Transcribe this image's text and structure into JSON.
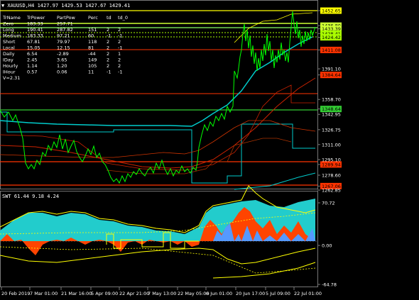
{
  "header": {
    "symbol_line": "▼ XAUUSD,H4  1427.97 1429.53 1427.67 1429.41",
    "indicator_line": "SWT 61.44 9.18 4.24"
  },
  "table": {
    "headers": [
      "TrName",
      "TrPower",
      "PartPow",
      "Perc",
      "td",
      "td_0"
    ],
    "rows": [
      [
        "Zero",
        "183.33",
        "257.71",
        "",
        "",
        ""
      ],
      [
        "Long",
        "190.41",
        "287.82",
        "151",
        "2",
        "2"
      ],
      [
        "Medium",
        "183.33",
        "97.21",
        "60",
        "-1",
        "-1"
      ],
      [
        "Short",
        "67.81",
        "79.97",
        "118",
        "2",
        "2"
      ],
      [
        "Local",
        "15.05",
        "12.15",
        "81",
        "2",
        "-1"
      ],
      [
        "Daily",
        "6.54",
        "-2.89",
        "-44",
        "2",
        "1"
      ],
      [
        "IDay",
        "2.45",
        "3.65",
        "149",
        "2",
        "2"
      ],
      [
        "Hourly",
        "1.14",
        "1.20",
        "105",
        "2",
        "2"
      ],
      [
        "IHour",
        "0.57",
        "0.06",
        "11",
        "-1",
        "-1"
      ]
    ],
    "footer": "V=2.31"
  },
  "price_axis": {
    "labels": [
      "1452.65",
      "1436.80",
      "1433.39",
      "1428.41",
      "1424.42",
      "1411.08",
      "1391.10",
      "1384.64",
      "1358.70",
      "1348.64",
      "1342.95",
      "1326.75",
      "1311.00",
      "1295.10",
      "1289.94",
      "1278.60",
      "1267.06",
      "1262.85"
    ],
    "highlighted": [
      "1452.65",
      "1436.80",
      "1433.39",
      "1428.41",
      "1424.42",
      "1411.08",
      "1384.64",
      "1348.64",
      "1289.94",
      "1267.06"
    ]
  },
  "sub_axis": {
    "labels": [
      "70.72",
      "0.00",
      "-64.78"
    ]
  },
  "time_axis": {
    "labels": [
      "20 Feb 2019",
      "7 Mar 01:00",
      "21 Mar 16:00",
      "5 Apr 09:00",
      "22 Apr 21:00",
      "7 May 13:00",
      "22 May 05:00",
      "6 Jun 01:00",
      "20 Jun 17:00",
      "5 Jul 09:00",
      "22 Jul 01:00"
    ]
  },
  "colors": {
    "background": "#000000",
    "price_line": "#00ff00",
    "support_line": "#ff3300",
    "green_level": "#33cc33",
    "yellow_level": "#ffff00",
    "cyan": "#00cccc",
    "histogram_orange": "#ff4400",
    "histogram_blue": "#5599ff",
    "histogram_cyan": "#22cccc"
  }
}
